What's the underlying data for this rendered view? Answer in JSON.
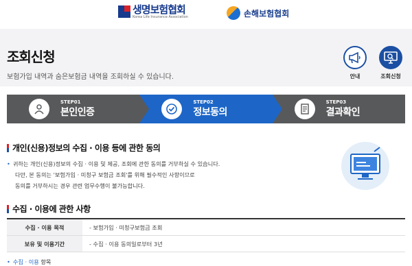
{
  "header": {
    "logo_life_ko": "생명보험협회",
    "logo_life_en": "Korea Life Insurance Association",
    "logo_nonlife": "손해보험협회"
  },
  "page": {
    "title": "조회신청",
    "description": "보험가입 내역과 숨은보험금 내역을 조회하실 수 있습니다."
  },
  "quick_buttons": [
    {
      "label": "안내",
      "icon": "megaphone-icon"
    },
    {
      "label": "조회신청",
      "icon": "monitor-search-icon"
    }
  ],
  "steps": [
    {
      "no": "STEP01",
      "name": "본인인증",
      "icon": "person-icon"
    },
    {
      "no": "STEP02",
      "name": "정보동의",
      "icon": "check-circle-icon"
    },
    {
      "no": "STEP03",
      "name": "결과확인",
      "icon": "document-icon"
    }
  ],
  "consent": {
    "title": "개인(신용)정보의 수집 · 이용 등에 관한 동의",
    "lines": [
      "귀하는 개인(신용)정보의 수집 · 이용 및 제공, 조회에 관한 동의를 거부하실 수 있습니다.",
      "다만, 본 동의는 '보험가입 · 미청구 보험금 조회'를 위해 필수적인 사항이므로",
      "동의를 거부하시는 경우 관련 업무수행이 불가능합니다."
    ]
  },
  "collect": {
    "title": "수집 · 이용에 관한 사항",
    "rows": [
      {
        "head": "수집 · 이용 목적",
        "value": "- 보험가입 · 미청구보험금 조회"
      },
      {
        "head": "보유 및 이용기간",
        "value": "- 수집 · 이용 동의일로부터 3년"
      }
    ],
    "bottom_highlight": "수집 · 이용",
    "bottom_rest": " 항목"
  },
  "colors": {
    "accent": "#1d66c7",
    "step_inactive": "#58595b",
    "brand_navy": "#173a8c",
    "brand_red": "#d9232a"
  }
}
